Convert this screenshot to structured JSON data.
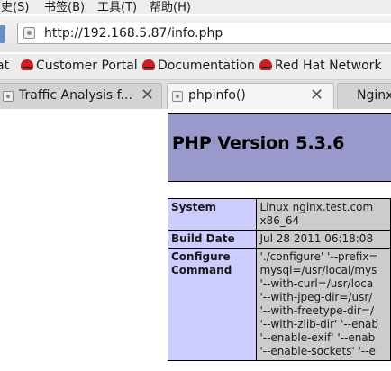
{
  "menubar": {
    "items": [
      "历史(S)",
      "书签(B)",
      "工具(T)",
      "帮助(H)"
    ]
  },
  "navbar": {
    "url": "http://192.168.5.87/info.php"
  },
  "bookmarks": {
    "items": [
      "at",
      "Customer Portal",
      "Documentation",
      "Red Hat Network"
    ]
  },
  "tabs": [
    {
      "label": "Traffic Analysis f...",
      "active": false
    },
    {
      "label": "phpinfo()",
      "active": true
    },
    {
      "label": "Nginx",
      "active": false
    }
  ],
  "page": {
    "title": "PHP Version 5.3.6",
    "rows": [
      {
        "key": "System",
        "lines": [
          "Linux nginx.test.com",
          "x86_64"
        ]
      },
      {
        "key": "Build Date",
        "lines": [
          "Jul 28 2011 06:18:08"
        ]
      },
      {
        "key": "Configure\nCommand",
        "lines": [
          "'./configure' '--prefix=",
          "mysql=/usr/local/mys",
          "'--with-curl=/usr/loca",
          "'--with-jpeg-dir=/usr/",
          "'--with-freetype-dir=/",
          "'--with-zlib-dir' '--enab",
          "'--enable-exif' '--enab",
          "'--enable-sockets' '--e"
        ]
      }
    ]
  }
}
